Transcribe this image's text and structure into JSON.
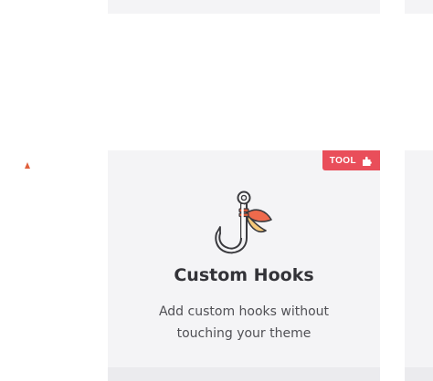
{
  "card": {
    "badge_label": "TOOL",
    "badge_icon": "puzzle-icon",
    "icon": "fishing-hook-icon",
    "title": "Custom Hooks",
    "description": "Add custom hooks without touching your theme"
  },
  "colors": {
    "badge_bg": "#e94e5a",
    "card_bg": "#f4f4f6",
    "title": "#333338",
    "description": "#505055"
  }
}
